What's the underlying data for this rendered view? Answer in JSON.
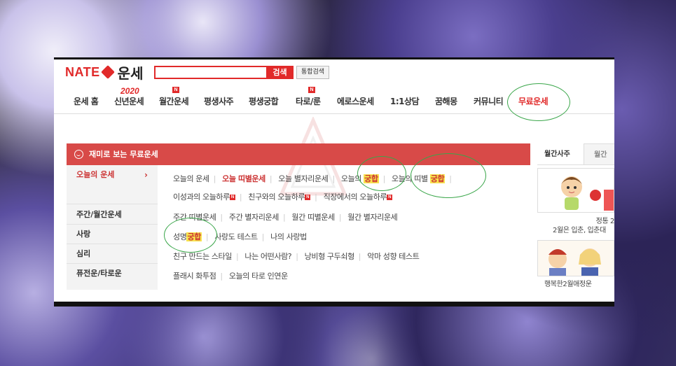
{
  "logo": {
    "brand": "NATE",
    "service": "운세"
  },
  "search": {
    "placeholder": "",
    "button": "검색",
    "total_button": "통합검색"
  },
  "nav": {
    "year_badge": "2020",
    "new_badge": "N",
    "items": [
      {
        "label": "운세 홈"
      },
      {
        "label": "신년운세"
      },
      {
        "label": "월간운세"
      },
      {
        "label": "평생사주"
      },
      {
        "label": "평생궁합"
      },
      {
        "label": "타로/룬"
      },
      {
        "label": "에로스운세"
      },
      {
        "label": "1:1상담"
      },
      {
        "label": "꿈해몽"
      },
      {
        "label": "커뮤니티"
      },
      {
        "label": "무료운세"
      }
    ]
  },
  "panel": {
    "header": "재미로 보는 무료운세",
    "side": [
      {
        "label": "오늘의 운세",
        "chevron": "›"
      },
      {
        "label": "주간/월간운세"
      },
      {
        "label": "사랑"
      },
      {
        "label": "심리"
      },
      {
        "label": "퓨전운/타로운"
      }
    ],
    "rows": {
      "today_1": [
        "오늘의 운세",
        "오늘 띠별운세",
        "오늘 별자리운세",
        "오늘의 ",
        "궁합",
        "오늘의 띠별 ",
        "궁합"
      ],
      "today_2": [
        "이성과의 오늘하루",
        "친구와의 오늘하루",
        "직장에서의 오늘하루"
      ],
      "weekly": [
        "주간 띠별운세",
        "주간 별자리운세",
        "월간 띠별운세",
        "월간 별자리운세"
      ],
      "love": [
        "성명",
        "궁합",
        "사랑도 테스트",
        "나의 사랑법"
      ],
      "psych": [
        "친구 만드는 스타일",
        "나는 어떤사람?",
        "낭비형 구두쇠형",
        "악마 성향 테스트"
      ],
      "fusion": [
        "플래시 화투점",
        "오늘의 타로 인연운"
      ]
    }
  },
  "right": {
    "tabs": [
      "월간사주",
      "월간"
    ],
    "cards": [
      {
        "caption_1": "정통 2",
        "caption_2": "2월은 입춘, 입춘대"
      },
      {
        "caption_1": "행복한2월애정운"
      }
    ]
  },
  "colors": {
    "brand_red": "#e12a2a",
    "header_red": "#d84a48",
    "highlight": "#f7e34d",
    "annotation_green": "#3aa64a"
  }
}
